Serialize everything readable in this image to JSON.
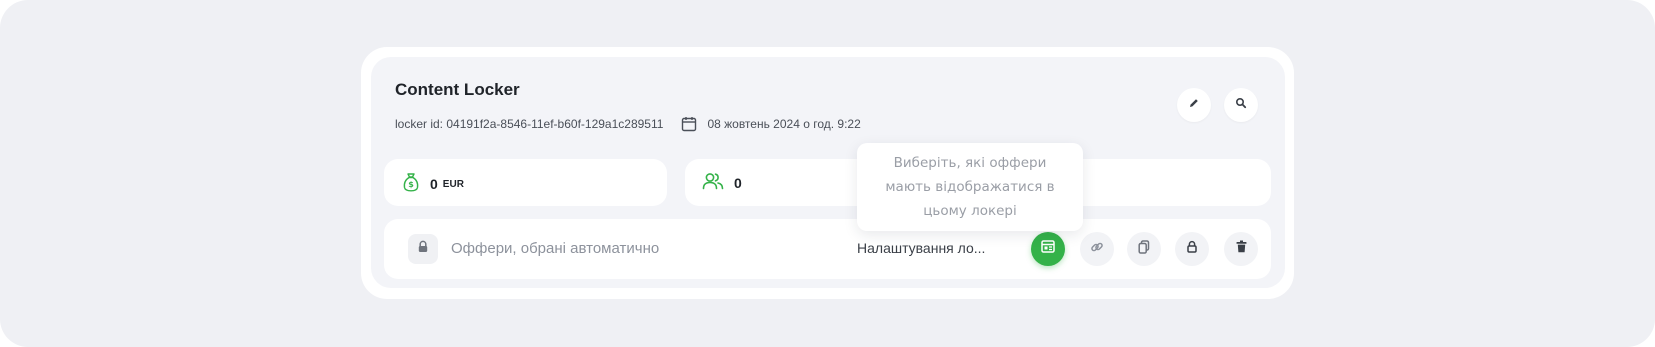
{
  "locker": {
    "title": "Content Locker",
    "id_text": "locker id: 04191f2a-8546-11ef-b60f-129a1c289511",
    "date_text": "08 жовтень 2024 о год. 9:22"
  },
  "stats": {
    "earnings_value": "0",
    "earnings_unit": "EUR",
    "users_value": "0"
  },
  "offers_row": {
    "offers_label": "Оффери, обрані автоматично",
    "settings_label": "Налаштування ло..."
  },
  "tooltip": {
    "text": "Виберіть, які оффери мають відображатися в цьому локері"
  },
  "colors": {
    "accent_green": "#34b249",
    "background": "#eff0f4",
    "card_inner": "#f3f4f8"
  },
  "icons": {
    "edit": "pencil-icon",
    "search": "search-icon",
    "money": "money-bag-icon",
    "users": "users-icon",
    "calendar": "calendar-icon",
    "lock": "lock-icon",
    "offer_settings": "offer-settings-icon",
    "link": "link-icon",
    "copy": "copy-icon",
    "locker": "padlock-icon",
    "delete": "trash-icon"
  }
}
